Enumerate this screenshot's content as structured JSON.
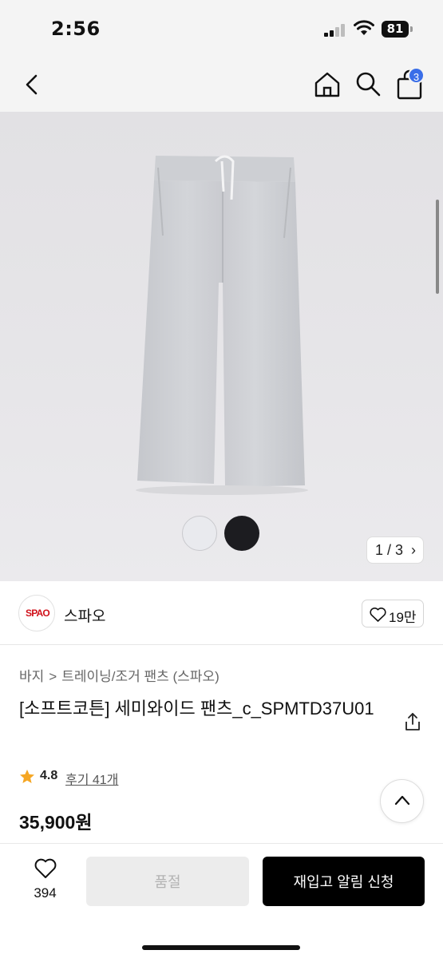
{
  "status_bar": {
    "time": "2:56",
    "battery": "81"
  },
  "nav": {
    "back_icon": "chevron-left-icon",
    "home_icon": "home-icon",
    "search_icon": "search-icon",
    "cart_icon": "shopping-bag-icon",
    "cart_count": "3"
  },
  "gallery": {
    "counter": "1 / 3",
    "counter_chevron": "›",
    "swatches": [
      "light-gray",
      "black"
    ]
  },
  "brand": {
    "logo_text": "SPAO",
    "name": "스파오",
    "like_count": "19만"
  },
  "product": {
    "breadcrumb": [
      "바지",
      "트레이닝/조거 팬츠 (스파오)"
    ],
    "breadcrumb_sep": ">",
    "title": "[소프트코튼] 세미와이드 팬츠_c_SPMTD37U01",
    "rating": "4.8",
    "review_link": "후기 41개",
    "price": "35,900원"
  },
  "bottom_bar": {
    "wish_count": "394",
    "soldout_label": "품절",
    "restock_label": "재입고 알림 신청"
  },
  "colors": {
    "accent_badge": "#3a6ee8",
    "brand_red": "#d0121b",
    "star": "#f5a623",
    "primary_button": "#000000"
  }
}
